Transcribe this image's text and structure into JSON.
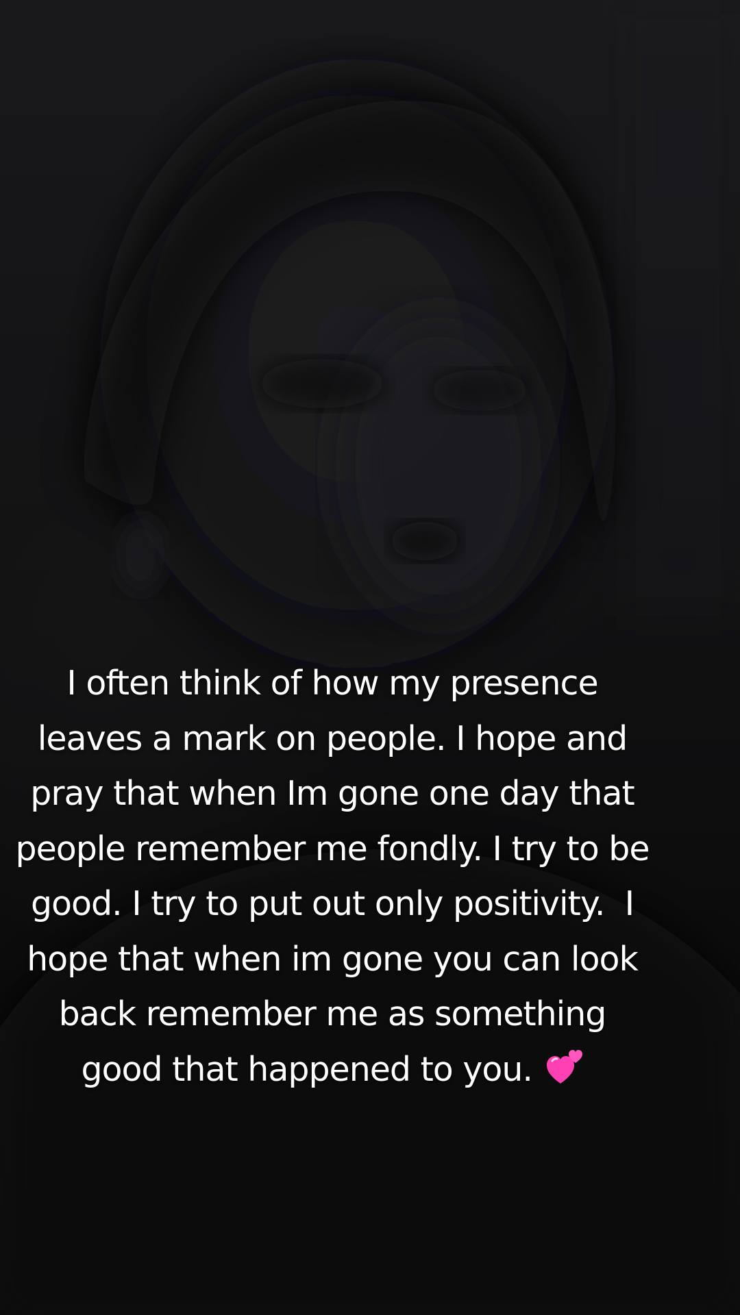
{
  "caption": {
    "lines": [
      "I often think of how my presence",
      "leaves a mark on people. I hope and",
      "pray that when Im gone one day that",
      "people remember me fondly. I try to be",
      "good. I try to put out only positivity.  I",
      "hope that when im gone you can look",
      "back remember me as something",
      "good that happened to you."
    ],
    "emoji": "two-hearts-icon",
    "emoji_color": "#ff3fb4"
  }
}
